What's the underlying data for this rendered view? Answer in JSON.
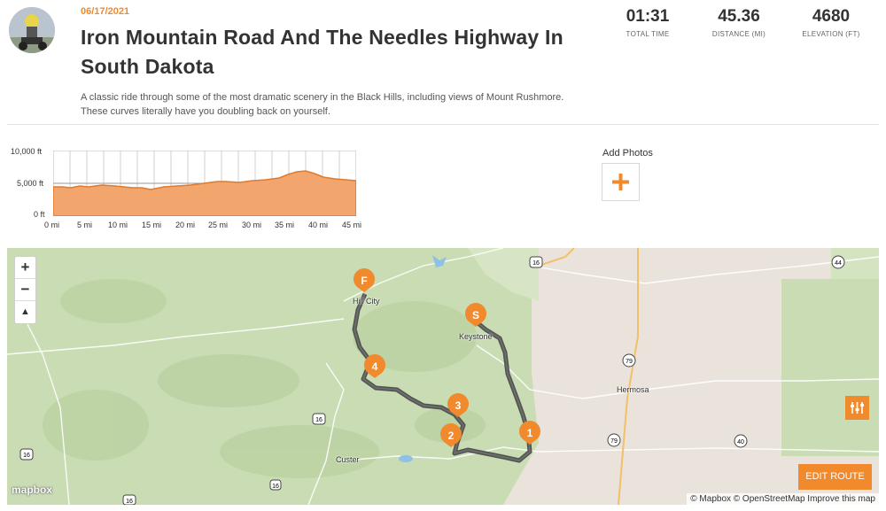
{
  "ride": {
    "date": "06/17/2021",
    "title": "Iron Mountain Road And The Needles Highway In South Dakota",
    "description": "A classic ride through some of the most dramatic scenery in the Black Hills, including views of Mount Rushmore. These curves literally have you doubling back on yourself."
  },
  "stats": [
    {
      "value": "01:31",
      "label": "TOTAL TIME"
    },
    {
      "value": "45.36",
      "label": "DISTANCE (MI)"
    },
    {
      "value": "4680",
      "label": "ELEVATION (FT)"
    }
  ],
  "elevation": {
    "y_labels": [
      "10,000 ft",
      "5,000 ft",
      "0 ft"
    ],
    "x_labels": [
      "0 mi",
      "5 mi",
      "10 mi",
      "15 mi",
      "20 mi",
      "25 mi",
      "30 mi",
      "35 mi",
      "40 mi",
      "45 mi"
    ],
    "color": "#f08a2c"
  },
  "photos": {
    "label": "Add Photos",
    "add_icon": "+"
  },
  "map": {
    "zoom_in": "+",
    "zoom_out": "−",
    "compass": "▲",
    "towns": [
      "Hill City",
      "Keystone",
      "Hermosa",
      "Custer"
    ],
    "markers": [
      "F",
      "S",
      "4",
      "3",
      "2",
      "1"
    ],
    "road_shields": [
      "16",
      "44",
      "79",
      "79",
      "16",
      "40",
      "16",
      "16",
      "16"
    ],
    "side_button_icon": "sliders-icon",
    "edit_route_label": "EDIT ROUTE",
    "logo_label": "mapbox",
    "attribution": "© Mapbox © OpenStreetMap Improve this map"
  }
}
